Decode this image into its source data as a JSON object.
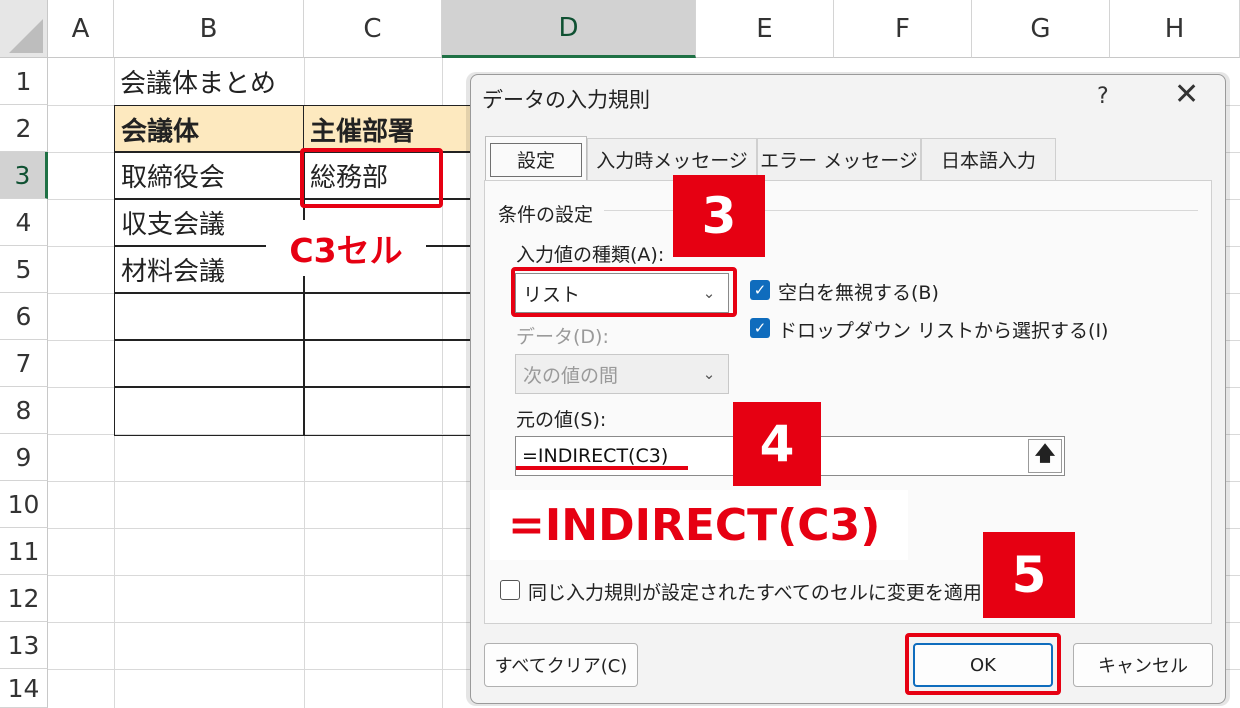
{
  "sheet": {
    "columns": [
      "A",
      "B",
      "C",
      "D",
      "E",
      "F",
      "G",
      "H"
    ],
    "selected_column": "D",
    "rows": [
      "1",
      "2",
      "3",
      "4",
      "5",
      "6",
      "7",
      "8",
      "9",
      "10",
      "11",
      "12",
      "13",
      "14"
    ],
    "selected_row": "3",
    "title_cell": "会議体まとめ",
    "table": {
      "headers": [
        "会議体",
        "主催部署"
      ],
      "rows": [
        [
          "取締役会",
          "総務部"
        ],
        [
          "収支会議",
          ""
        ],
        [
          "材料会議",
          ""
        ],
        [
          "",
          ""
        ],
        [
          "",
          ""
        ],
        [
          "",
          ""
        ]
      ]
    },
    "callout_c3": "C3セル",
    "header_fill": "#fde9bf"
  },
  "dialog": {
    "title": "データの入力規則",
    "help": "?",
    "close": "✕",
    "tabs": [
      "設定",
      "入力時メッセージ",
      "エラー メッセージ",
      "日本語入力"
    ],
    "active_tab": "設定",
    "group_label": "条件の設定",
    "allow_label": "入力値の種類(A):",
    "allow_value": "リスト",
    "ignore_blank_label": "空白を無視する(B)",
    "ignore_blank_checked": true,
    "dropdown_label": "ドロップダウン リストから選択する(I)",
    "dropdown_checked": true,
    "data_label": "データ(D):",
    "data_value": "次の値の間",
    "source_label": "元の値(S):",
    "source_value": "=INDIRECT(C3)",
    "apply_all_label": "同じ入力規則が設定されたすべてのセルに変更を適用する",
    "apply_all_checked": false,
    "clear_all": "すべてクリア(C)",
    "ok": "OK",
    "cancel": "キャンセル"
  },
  "annotations": {
    "step3": "3",
    "step4": "4",
    "step5": "5",
    "formula_callout": "=INDIRECT(C3)",
    "accent_color": "#e60012"
  }
}
